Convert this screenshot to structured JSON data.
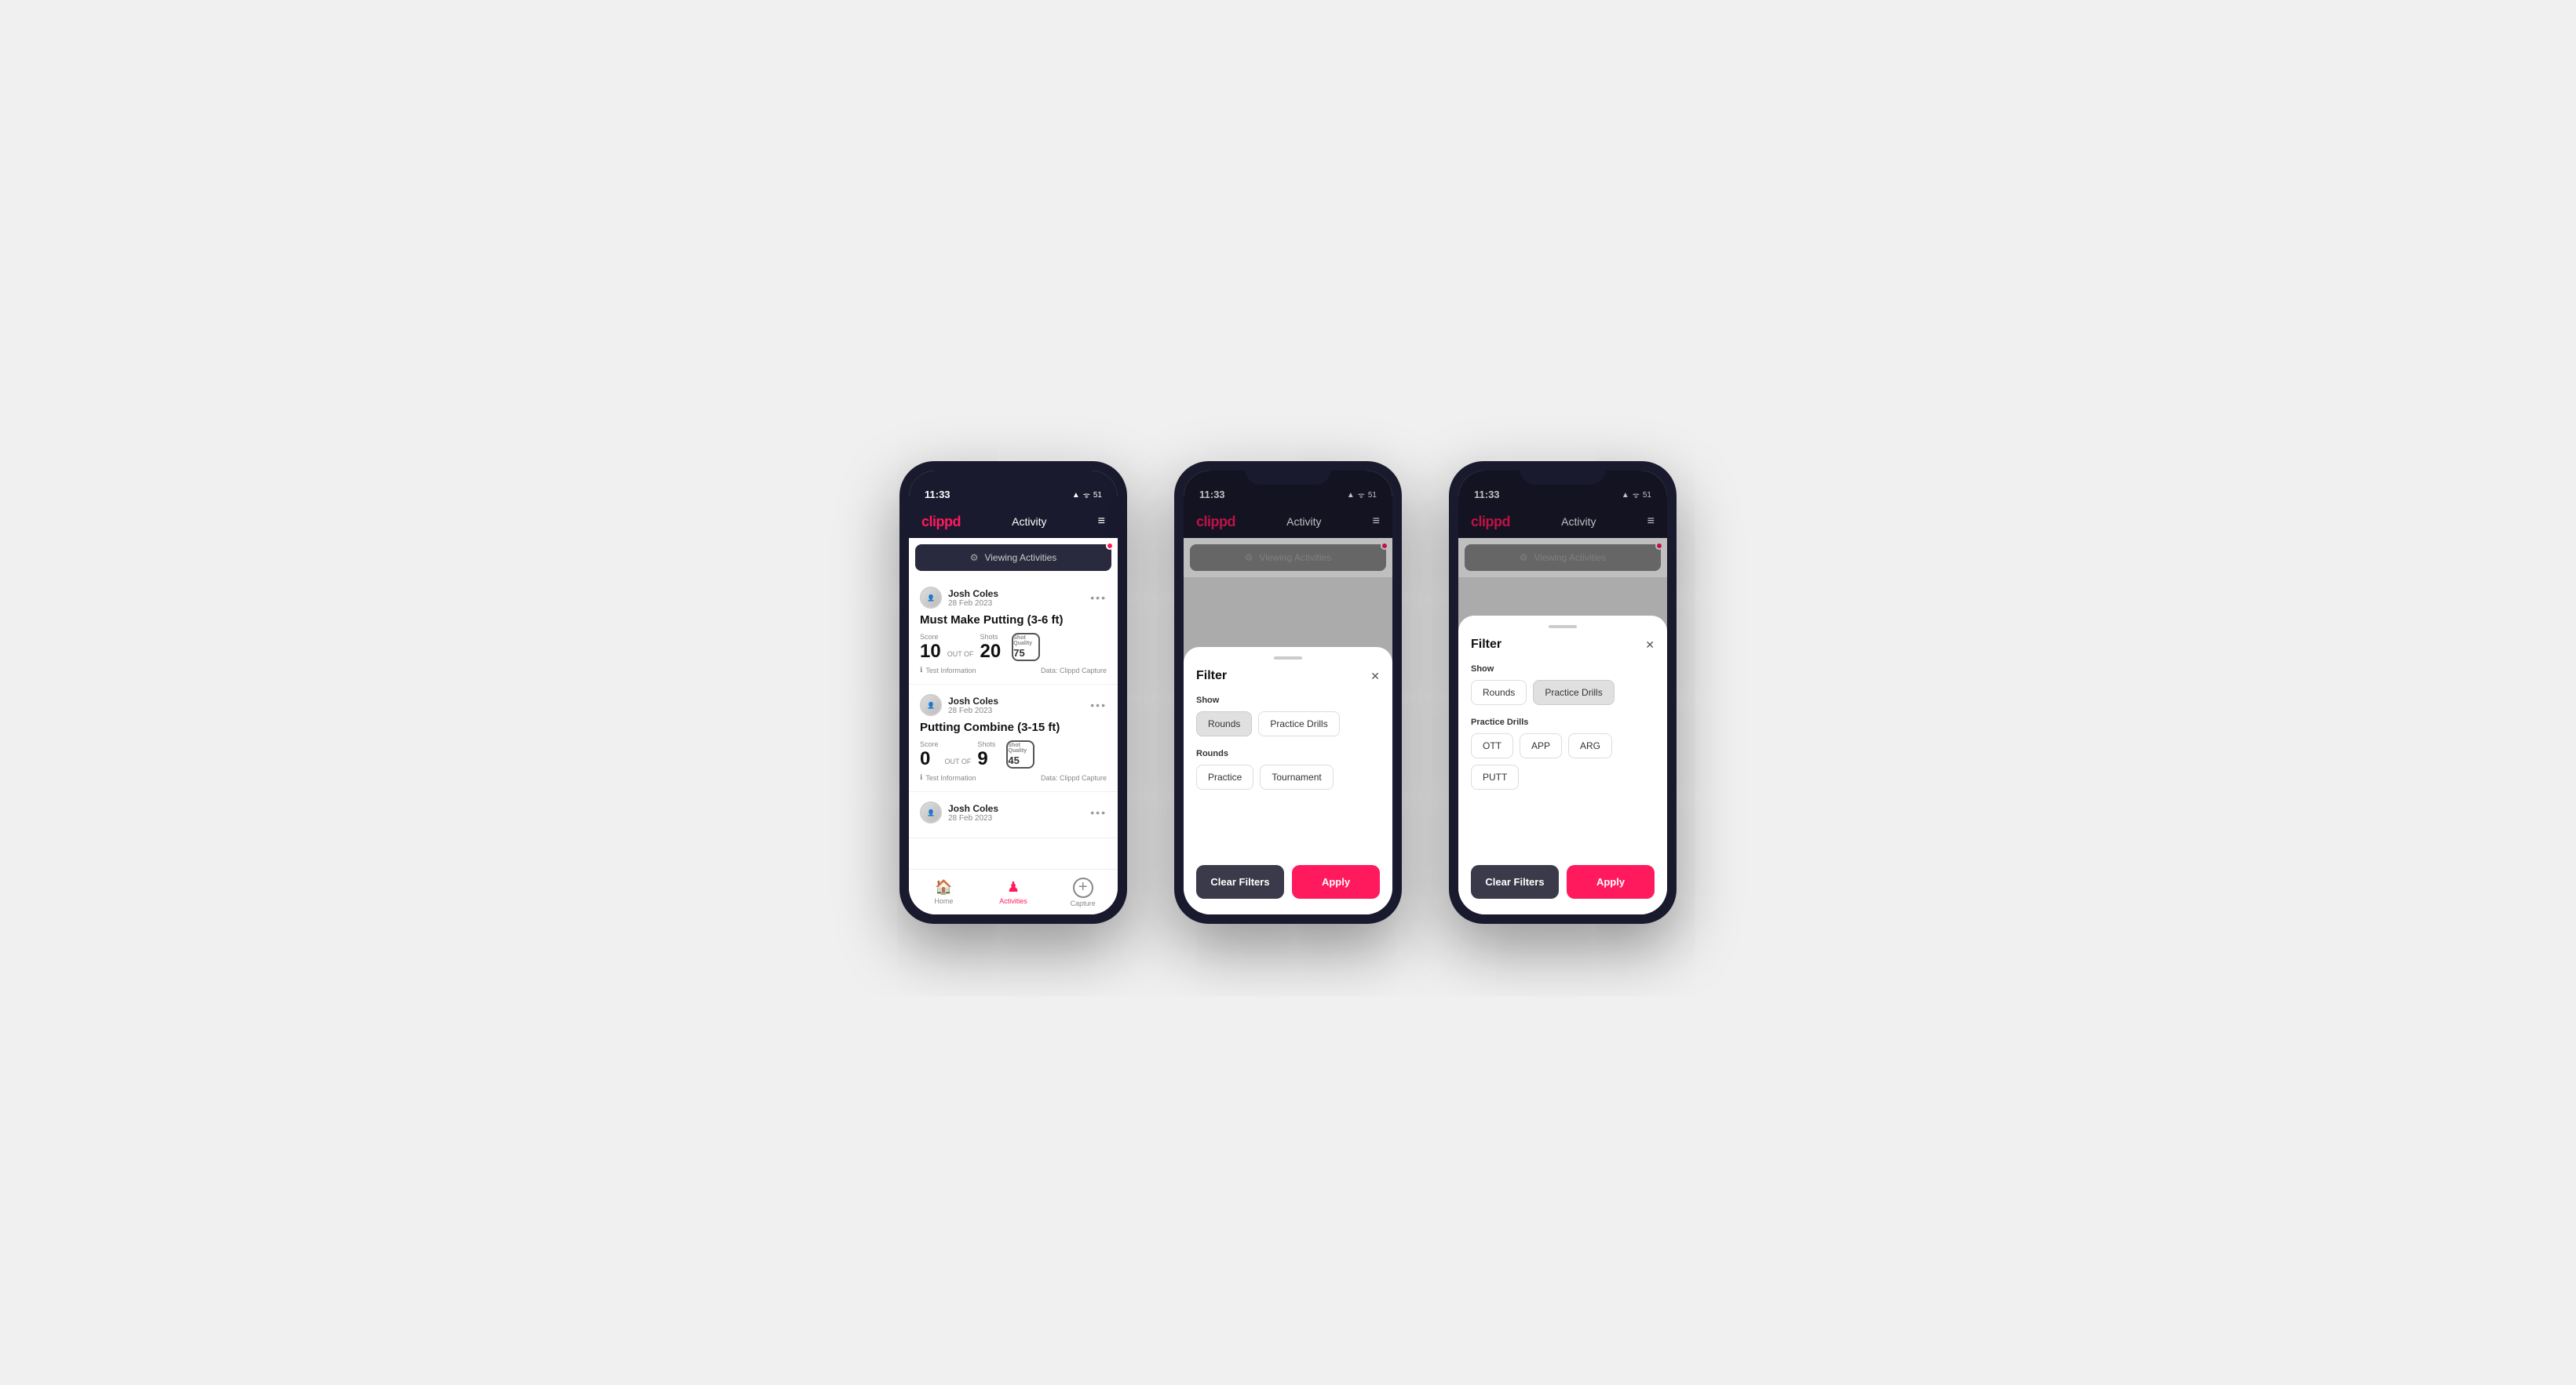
{
  "phones": [
    {
      "id": "phone1",
      "statusBar": {
        "time": "11:33",
        "icons": "▲ ᯤ 51"
      },
      "navBar": {
        "logo": "clippd",
        "title": "Activity",
        "menuIcon": "≡"
      },
      "viewingBar": {
        "icon": "⚙",
        "text": "Viewing Activities",
        "hasDot": true
      },
      "activities": [
        {
          "userName": "Josh Coles",
          "userDate": "28 Feb 2023",
          "title": "Must Make Putting (3-6 ft)",
          "score": "10",
          "outOf": "OUT OF",
          "shots": "20",
          "shotQuality": "75",
          "scoreSectionLabel": "Score",
          "shotsSectionLabel": "Shots",
          "shotQualityLabel": "Shot Quality",
          "testInfo": "Test Information",
          "dataSource": "Data: Clippd Capture"
        },
        {
          "userName": "Josh Coles",
          "userDate": "28 Feb 2023",
          "title": "Putting Combine (3-15 ft)",
          "score": "0",
          "outOf": "OUT OF",
          "shots": "9",
          "shotQuality": "45",
          "scoreSectionLabel": "Score",
          "shotsSectionLabel": "Shots",
          "shotQualityLabel": "Shot Quality",
          "testInfo": "Test Information",
          "dataSource": "Data: Clippd Capture"
        },
        {
          "userName": "Josh Coles",
          "userDate": "28 Feb 2023",
          "title": "",
          "score": "",
          "outOf": "",
          "shots": "",
          "shotQuality": "",
          "scoreSectionLabel": "",
          "shotsSectionLabel": "",
          "shotQualityLabel": "",
          "testInfo": "",
          "dataSource": ""
        }
      ],
      "bottomNav": [
        {
          "icon": "🏠",
          "label": "Home",
          "active": false
        },
        {
          "icon": "♟",
          "label": "Activities",
          "active": true
        },
        {
          "icon": "+",
          "label": "Capture",
          "active": false
        }
      ],
      "showSheet": false
    },
    {
      "id": "phone2",
      "statusBar": {
        "time": "11:33",
        "icons": "▲ ᯤ 51"
      },
      "navBar": {
        "logo": "clippd",
        "title": "Activity",
        "menuIcon": "≡"
      },
      "viewingBar": {
        "icon": "⚙",
        "text": "Viewing Activities",
        "hasDot": true
      },
      "showSheet": true,
      "sheet": {
        "title": "Filter",
        "showSection": "Show",
        "showButtons": [
          {
            "label": "Rounds",
            "active": true
          },
          {
            "label": "Practice Drills",
            "active": false
          }
        ],
        "roundsSection": "Rounds",
        "roundsButtons": [
          {
            "label": "Practice",
            "active": false
          },
          {
            "label": "Tournament",
            "active": false
          }
        ],
        "practiceSection": null,
        "practiceButtons": [],
        "clearLabel": "Clear Filters",
        "applyLabel": "Apply"
      }
    },
    {
      "id": "phone3",
      "statusBar": {
        "time": "11:33",
        "icons": "▲ ᯤ 51"
      },
      "navBar": {
        "logo": "clippd",
        "title": "Activity",
        "menuIcon": "≡"
      },
      "viewingBar": {
        "icon": "⚙",
        "text": "Viewing Activities",
        "hasDot": true
      },
      "showSheet": true,
      "sheet": {
        "title": "Filter",
        "showSection": "Show",
        "showButtons": [
          {
            "label": "Rounds",
            "active": false
          },
          {
            "label": "Practice Drills",
            "active": true
          }
        ],
        "roundsSection": null,
        "roundsButtons": [],
        "practiceSection": "Practice Drills",
        "practiceButtons": [
          {
            "label": "OTT",
            "active": false
          },
          {
            "label": "APP",
            "active": false
          },
          {
            "label": "ARG",
            "active": false
          },
          {
            "label": "PUTT",
            "active": false
          }
        ],
        "clearLabel": "Clear Filters",
        "applyLabel": "Apply"
      }
    }
  ]
}
